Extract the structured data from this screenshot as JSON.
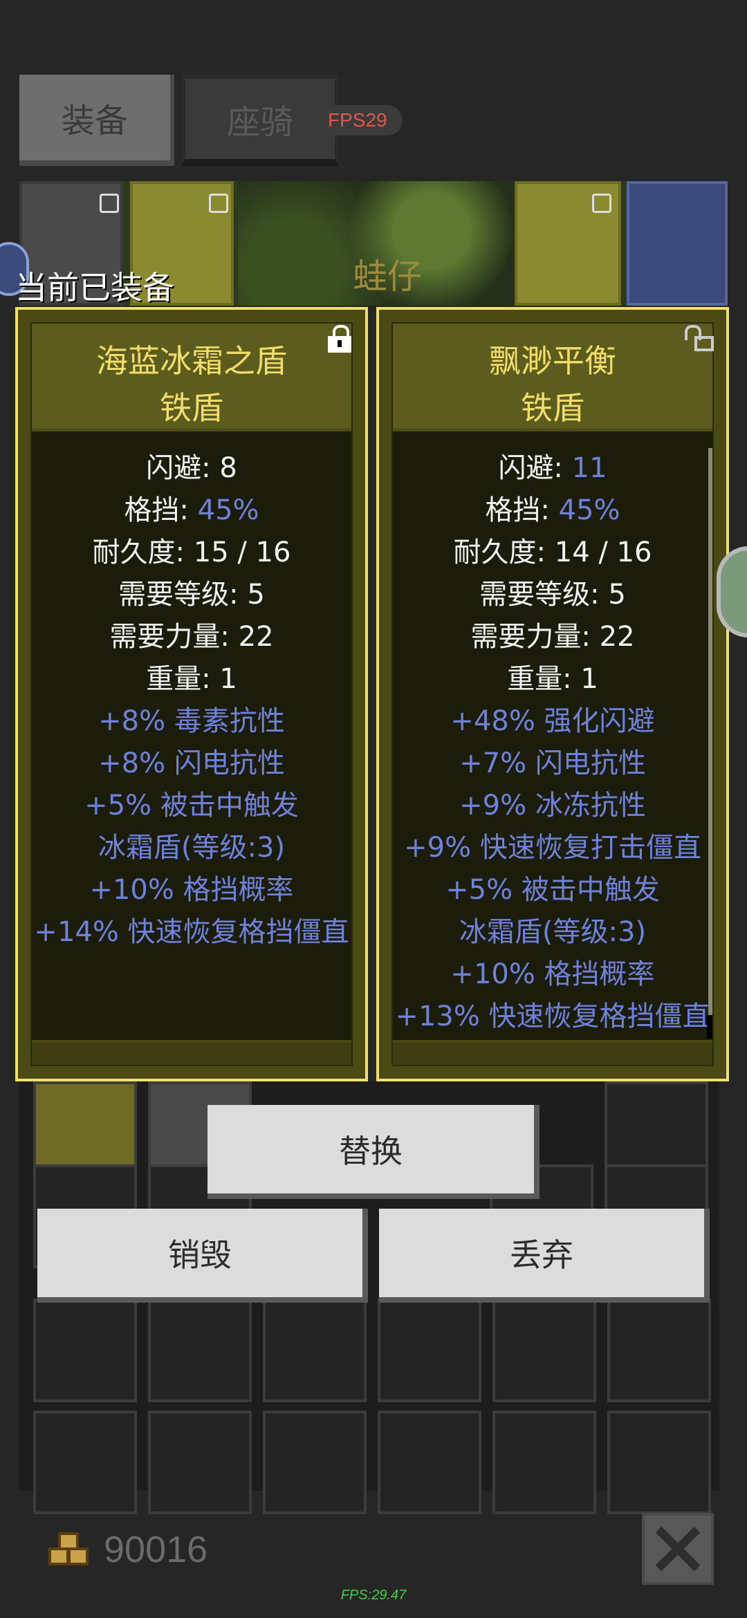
{
  "tabs": [
    {
      "label": "装备",
      "active": true
    },
    {
      "label": "座骑",
      "active": false
    }
  ],
  "fps_badge": "FPS29",
  "player_name": "蛙仔",
  "current_equipped_label": "当前已装备",
  "left_item": {
    "name": "海蓝冰霜之盾",
    "type": "铁盾",
    "locked": true,
    "stats": [
      {
        "label": "闪避: ",
        "value": "8",
        "highlight": false
      },
      {
        "label": "格挡: ",
        "value": "45%",
        "highlight": true
      },
      {
        "label": "耐久度: ",
        "value": "15 / 16",
        "highlight": false
      },
      {
        "label": "需要等级: ",
        "value": "5",
        "highlight": false
      },
      {
        "label": "需要力量: ",
        "value": "22",
        "highlight": false
      },
      {
        "label": "重量: ",
        "value": "1",
        "highlight": false
      }
    ],
    "affixes": [
      "+8% 毒素抗性",
      "+8% 闪电抗性",
      "+5% 被击中触发",
      "冰霜盾(等级:3)",
      "+10% 格挡概率",
      "+14% 快速恢复格挡僵直"
    ]
  },
  "right_item": {
    "name": "飘渺平衡",
    "type": "铁盾",
    "locked": false,
    "stats": [
      {
        "label": "闪避: ",
        "value": "11",
        "highlight": true
      },
      {
        "label": "格挡: ",
        "value": "45%",
        "highlight": true
      },
      {
        "label": "耐久度: ",
        "value": "14 / 16",
        "highlight": false
      },
      {
        "label": "需要等级: ",
        "value": "5",
        "highlight": false
      },
      {
        "label": "需要力量: ",
        "value": "22",
        "highlight": false
      },
      {
        "label": "重量: ",
        "value": "1",
        "highlight": false
      }
    ],
    "affixes": [
      "+48% 强化闪避",
      "+7% 闪电抗性",
      "+9% 冰冻抗性",
      "+9% 快速恢复打击僵直",
      "+5% 被击中触发",
      "冰霜盾(等级:3)",
      "+10% 格挡概率",
      "+13% 快速恢复格挡僵直"
    ]
  },
  "actions": {
    "replace": "替换",
    "destroy": "销毁",
    "discard": "丢弃"
  },
  "gold": "90016",
  "fps_footer": "FPS:29.47",
  "colors": {
    "highlight_blue": "#6f82db",
    "item_name_gold": "#f2dd6a",
    "card_border": "#f0e070"
  },
  "icons": [
    "lock-icon",
    "unlock-icon",
    "gold-coins-icon",
    "close-icon",
    "chat-bubble-icon"
  ]
}
